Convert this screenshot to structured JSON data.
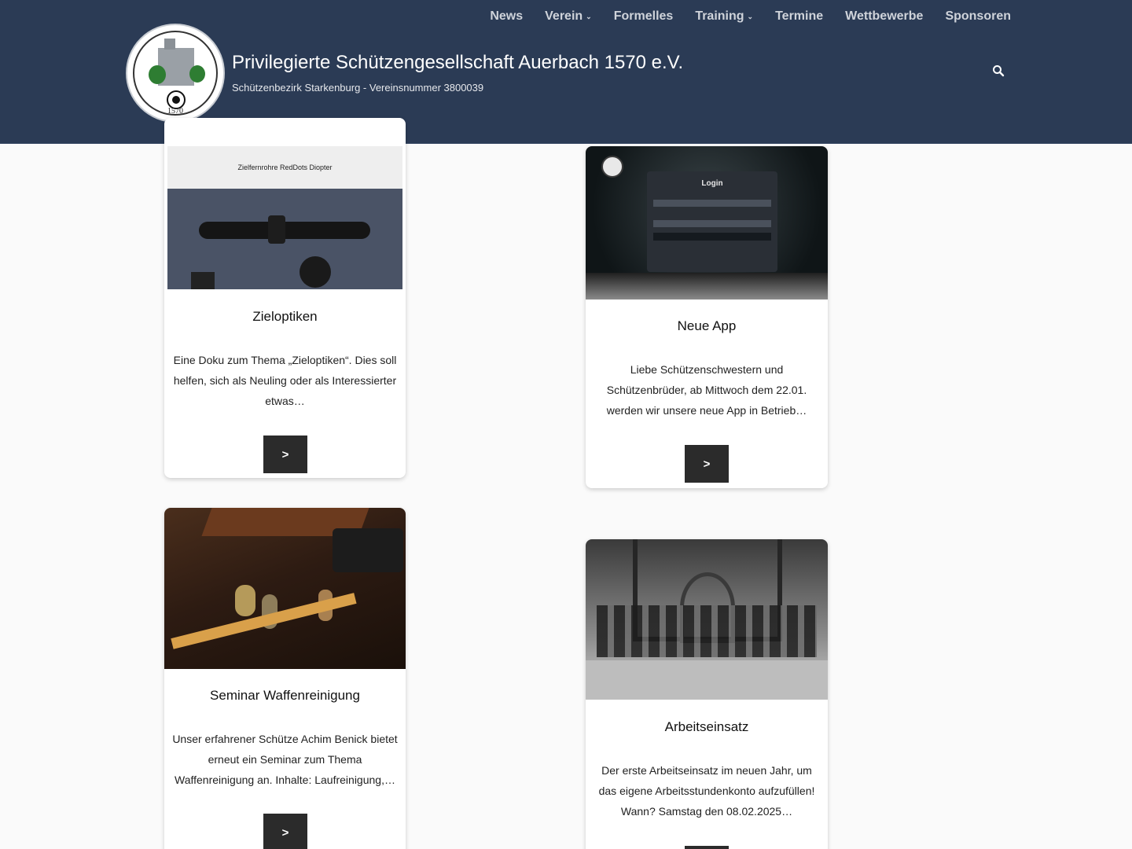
{
  "nav": {
    "items": [
      {
        "label": "News",
        "has_dropdown": false
      },
      {
        "label": "Verein",
        "has_dropdown": true
      },
      {
        "label": "Formelles",
        "has_dropdown": false
      },
      {
        "label": "Training",
        "has_dropdown": true
      },
      {
        "label": "Termine",
        "has_dropdown": false
      },
      {
        "label": "Wettbewerbe",
        "has_dropdown": false
      },
      {
        "label": "Sponsoren",
        "has_dropdown": false
      }
    ]
  },
  "header": {
    "title": "Privilegierte Schützengesellschaft Auerbach 1570 e.V.",
    "subtitle": "Schützenbezirk Starkenburg - Vereinsnummer 3800039",
    "logo_year": "1570",
    "search_icon": "search-icon"
  },
  "posts": [
    {
      "title": "Zieloptiken",
      "excerpt": "Eine Doku zum Thema „Zieloptiken“. Dies soll helfen, sich als Neuling oder als Interessierter etwas…",
      "button": ">",
      "image_caption": "Zielfernrohre   RedDots   Diopter"
    },
    {
      "title": "Neue App",
      "excerpt": "Liebe Schützenschwestern und Schützenbrüder, ab Mittwoch dem 22.01. werden wir unsere neue App in Betrieb…",
      "button": ">",
      "image_caption": "Login"
    },
    {
      "title": "Seminar Waffenreinigung",
      "excerpt": "Unser erfahrener Schütze Achim Benick bietet erneut ein Seminar zum Thema Waffenreinigung an. Inhalte: Laufreinigung,…",
      "button": ">"
    },
    {
      "title": "Arbeitseinsatz",
      "excerpt": "Der erste Arbeitseinsatz im neuen Jahr, um das eigene Arbeitsstundenkonto aufzufüllen! Wann? Samstag den 08.02.2025…",
      "button": ">"
    }
  ],
  "colors": {
    "header_bg": "#2b3b55",
    "nav_text": "#cfd3da",
    "button_bg": "#2b2b2b",
    "page_bg": "#fafafa"
  }
}
